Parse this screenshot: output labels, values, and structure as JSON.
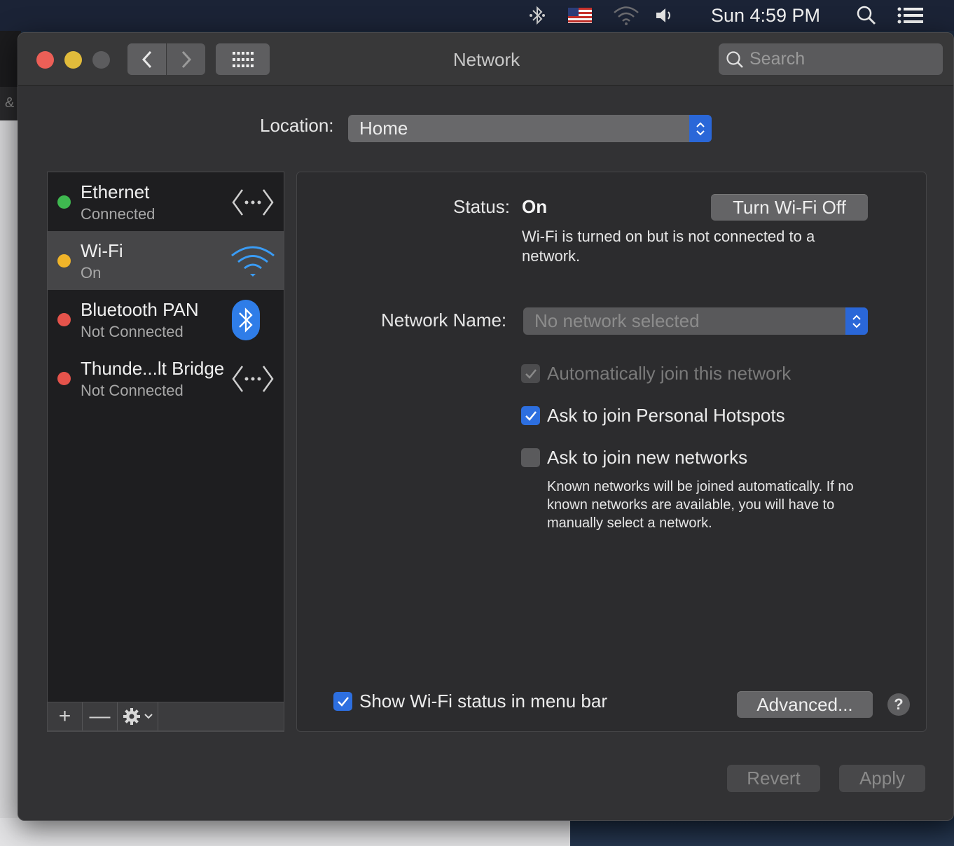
{
  "menubar": {
    "clock": "Sun 4:59 PM",
    "icons": [
      "bluetooth-icon",
      "us-flag-icon",
      "wifi-icon",
      "volume-icon",
      "spotlight-search-icon",
      "notification-center-icon"
    ]
  },
  "window": {
    "title": "Network",
    "search_placeholder": "Search"
  },
  "location": {
    "label": "Location:",
    "value": "Home"
  },
  "services": [
    {
      "name": "Ethernet",
      "status": "Connected",
      "dot_color": "#3fb950",
      "icon": "ethernet-arrows-icon",
      "selected": false
    },
    {
      "name": "Wi-Fi",
      "status": "On",
      "dot_color": "#f0b429",
      "icon": "wifi-icon",
      "selected": true
    },
    {
      "name": "Bluetooth PAN",
      "status": "Not Connected",
      "dot_color": "#e5534b",
      "icon": "bluetooth-icon",
      "selected": false
    },
    {
      "name": "Thunde...lt Bridge",
      "status": "Not Connected",
      "dot_color": "#e5534b",
      "icon": "thunderbolt-arrows-icon",
      "selected": false
    }
  ],
  "service_toolbar": {
    "add": "+",
    "remove": "—"
  },
  "wifi_panel": {
    "status_label": "Status:",
    "status_value": "On",
    "turn_off_button": "Turn Wi-Fi Off",
    "status_description": "Wi-Fi is turned on but is not connected to a network.",
    "network_name_label": "Network Name:",
    "network_name_value": "No network selected",
    "auto_join_label": "Automatically join this network",
    "auto_join_checked": true,
    "auto_join_disabled": true,
    "hotspots_label": "Ask to join Personal Hotspots",
    "hotspots_checked": true,
    "new_networks_label": "Ask to join new networks",
    "new_networks_checked": false,
    "new_networks_note": "Known networks will be joined automatically. If no known networks are available, you will have to manually select a network.",
    "show_status_label": "Show Wi-Fi status in menu bar",
    "show_status_checked": true,
    "advanced_button": "Advanced...",
    "help_button": "?"
  },
  "footer": {
    "revert_button": "Revert",
    "apply_button": "Apply"
  },
  "colors": {
    "accent": "#2d6fe0",
    "window_bg": "#323234",
    "sidebar_bg": "#1e1e20"
  }
}
